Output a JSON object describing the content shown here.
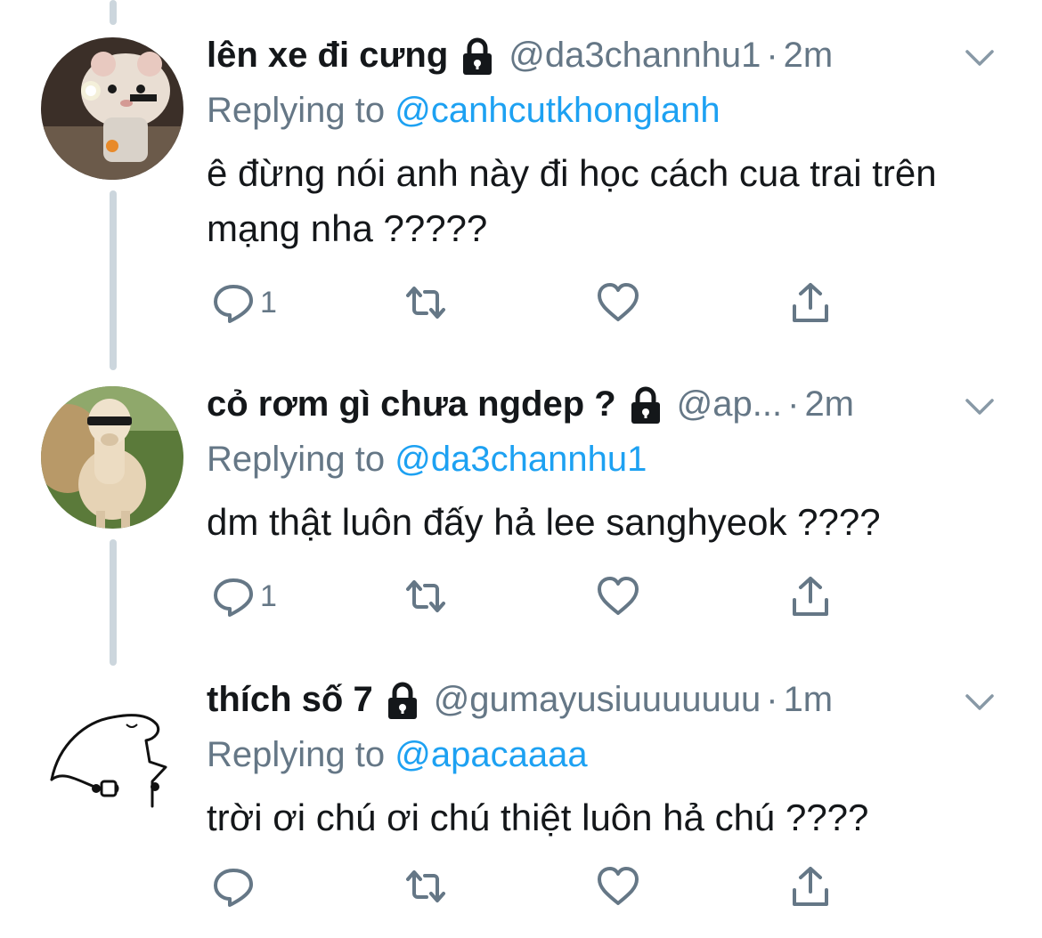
{
  "tweets": [
    {
      "name": "lên xe đi cưng",
      "handle": "@da3channhu1",
      "dot": "·",
      "time": "2m",
      "replying_prefix": "Replying to",
      "replying_to": "@canhcutkhonglanh",
      "text": "ê đừng nói anh này đi học cách cua trai trên mạng nha ?????",
      "reply_count": "1",
      "avatar": "hamster-avatar"
    },
    {
      "name": "cỏ rơm gì chưa ngdep ?",
      "handle": "@ap...",
      "dot": "·",
      "time": "2m",
      "replying_prefix": "Replying to",
      "replying_to": "@da3channhu1",
      "text": "dm thật luôn đấy hả lee sanghyeok ????",
      "reply_count": "1",
      "avatar": "alpaca-avatar"
    },
    {
      "name": "thích số 7",
      "handle": "@gumayusiuuuuuuu",
      "dot": "·",
      "time": "1m",
      "replying_prefix": "Replying to",
      "replying_to": "@apacaaaa",
      "text": "trời ơi chú ơi chú thiệt luôn hả chú ????",
      "reply_count": "",
      "avatar": "doodle-avatar"
    }
  ],
  "colors": {
    "text": "#14171a",
    "secondary": "#657786",
    "link": "#1da1f2",
    "thread_line": "#ccd6dd"
  },
  "icons": {
    "lock": "lock-icon",
    "chevron": "chevron-down-icon",
    "reply": "reply-icon",
    "retweet": "retweet-icon",
    "like": "heart-icon",
    "share": "share-icon"
  }
}
